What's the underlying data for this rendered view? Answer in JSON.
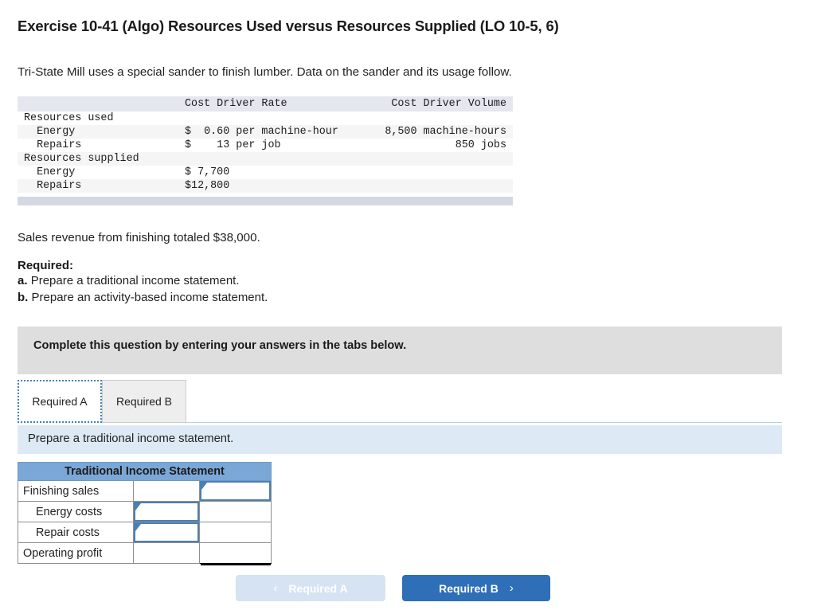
{
  "title": "Exercise 10-41 (Algo) Resources Used versus Resources Supplied (LO 10-5, 6)",
  "intro": "Tri-State Mill uses a special sander to finish lumber. Data on the sander and its usage follow.",
  "data_table": {
    "headers": [
      "",
      "Cost Driver Rate",
      "Cost Driver Volume"
    ],
    "rows": [
      {
        "label": "Resources used",
        "rate": "",
        "volume": ""
      },
      {
        "label": "  Energy",
        "rate": "$  0.60 per machine-hour",
        "volume": "8,500 machine-hours"
      },
      {
        "label": "  Repairs",
        "rate": "$    13 per job",
        "volume": "850 jobs"
      },
      {
        "label": "Resources supplied",
        "rate": "",
        "volume": ""
      },
      {
        "label": "  Energy",
        "rate": "$ 7,700",
        "volume": ""
      },
      {
        "label": "  Repairs",
        "rate": "$12,800",
        "volume": ""
      }
    ]
  },
  "sales_line": "Sales revenue from finishing totaled $38,000.",
  "required": {
    "heading": "Required:",
    "item_a_marker": "a.",
    "item_a_text": "Prepare a traditional income statement.",
    "item_b_marker": "b.",
    "item_b_text": "Prepare an activity-based income statement."
  },
  "banner": {
    "text": "Complete this question by entering your answers in the tabs below."
  },
  "tabs": [
    {
      "label": "Required A",
      "active": true
    },
    {
      "label": "Required B",
      "active": false
    }
  ],
  "subbar": {
    "text": "Prepare a traditional income statement."
  },
  "answer_table": {
    "header": "Traditional Income Statement",
    "rows": [
      {
        "label": "Finishing sales",
        "indent": false,
        "mid_value": "",
        "right_value": ""
      },
      {
        "label": "Energy costs",
        "indent": true,
        "mid_value": "",
        "right_value": ""
      },
      {
        "label": "Repair costs",
        "indent": true,
        "mid_value": "",
        "right_value": ""
      },
      {
        "label": "Operating profit",
        "indent": false,
        "mid_value": "",
        "right_value": ""
      }
    ]
  },
  "footer": {
    "prev_label": "Required A",
    "next_label": "Required B",
    "prev_chevron": "‹",
    "next_chevron": "›"
  },
  "colors": {
    "accent_blue": "#2e6fb7",
    "table_header_blue": "#7ba7d7",
    "subbar_blue": "#ddeaf6",
    "banner_gray": "#dedede",
    "input_border": "#4a7fb5"
  }
}
